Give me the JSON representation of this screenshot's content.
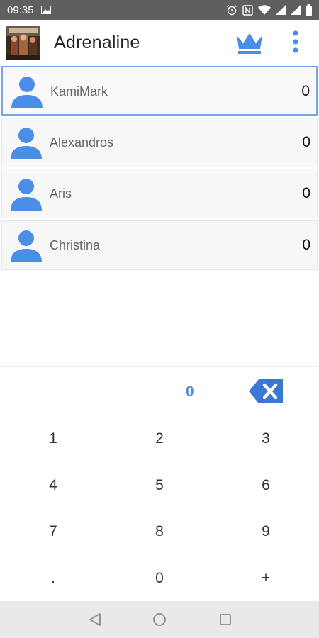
{
  "status_bar": {
    "time": "09:35"
  },
  "app_bar": {
    "title": "Adrenaline"
  },
  "players": [
    {
      "name": "KamiMark",
      "score": "0",
      "selected": true
    },
    {
      "name": "Alexandros",
      "score": "0",
      "selected": false
    },
    {
      "name": "Aris",
      "score": "0",
      "selected": false
    },
    {
      "name": "Christina",
      "score": "0",
      "selected": false
    }
  ],
  "keypad": {
    "entry_value": "0",
    "keys": [
      "1",
      "2",
      "3",
      "4",
      "5",
      "6",
      "7",
      "8",
      "9",
      ".",
      "0",
      "+"
    ]
  },
  "colors": {
    "accent": "#4f8fe6",
    "status_bar": "#5f5f5f",
    "selected_border": "#7aa3e8",
    "backspace": "#3a78d4"
  },
  "icons": {
    "app_bar": [
      "app-logo",
      "crown-icon",
      "overflow-menu-icon"
    ],
    "player_row": "person-icon",
    "keypad": "backspace-icon",
    "nav_bar": [
      "back-triangle-icon",
      "home-circle-icon",
      "recents-square-icon"
    ]
  }
}
